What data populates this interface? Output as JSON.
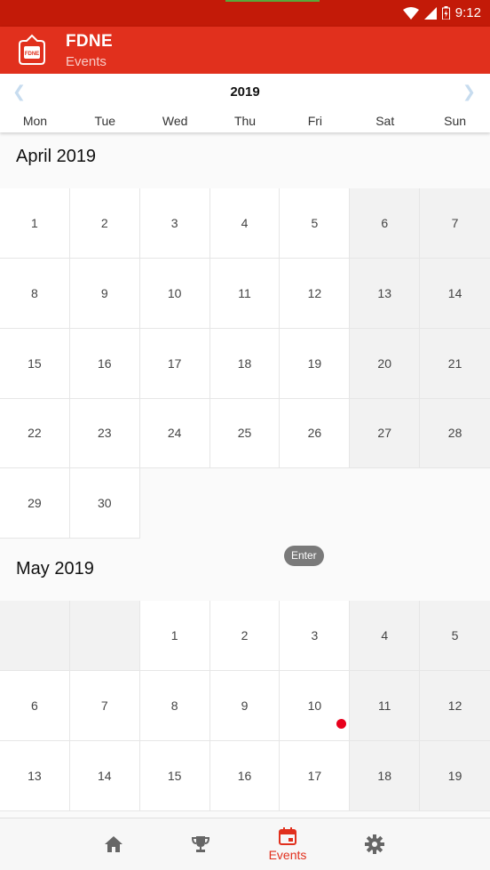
{
  "status_bar": {
    "time": "9:12"
  },
  "app": {
    "title": "FDNE",
    "subtitle": "Events",
    "logo_text": "FDNE"
  },
  "calendar_header": {
    "year": "2019",
    "weekdays": [
      "Mon",
      "Tue",
      "Wed",
      "Thu",
      "Fri",
      "Sat",
      "Sun"
    ]
  },
  "months": [
    {
      "title": "April 2019",
      "rows": [
        [
          "1",
          "2",
          "3",
          "4",
          "5",
          "6",
          "7"
        ],
        [
          "8",
          "9",
          "10",
          "11",
          "12",
          "13",
          "14"
        ],
        [
          "15",
          "16",
          "17",
          "18",
          "19",
          "20",
          "21"
        ],
        [
          "22",
          "23",
          "24",
          "25",
          "26",
          "27",
          "28"
        ],
        [
          "29",
          "30"
        ]
      ]
    },
    {
      "title": "May 2019",
      "rows": [
        [
          "",
          "",
          "1",
          "2",
          "3",
          "4",
          "5"
        ],
        [
          "6",
          "7",
          "8",
          "9",
          "10",
          "11",
          "12"
        ],
        [
          "13",
          "14",
          "15",
          "16",
          "17",
          "18",
          "19"
        ]
      ]
    }
  ],
  "event_days": [
    "May 10"
  ],
  "enter_button": "Enter",
  "bottom_nav": [
    {
      "icon": "home-icon",
      "label": ""
    },
    {
      "icon": "trophy-icon",
      "label": ""
    },
    {
      "icon": "calendar-icon",
      "label": "Events",
      "active": true
    },
    {
      "icon": "gear-icon",
      "label": ""
    }
  ],
  "colors": {
    "primary": "#e1301d",
    "status_bar": "#c31a08",
    "event_dot": "#e8001c"
  }
}
